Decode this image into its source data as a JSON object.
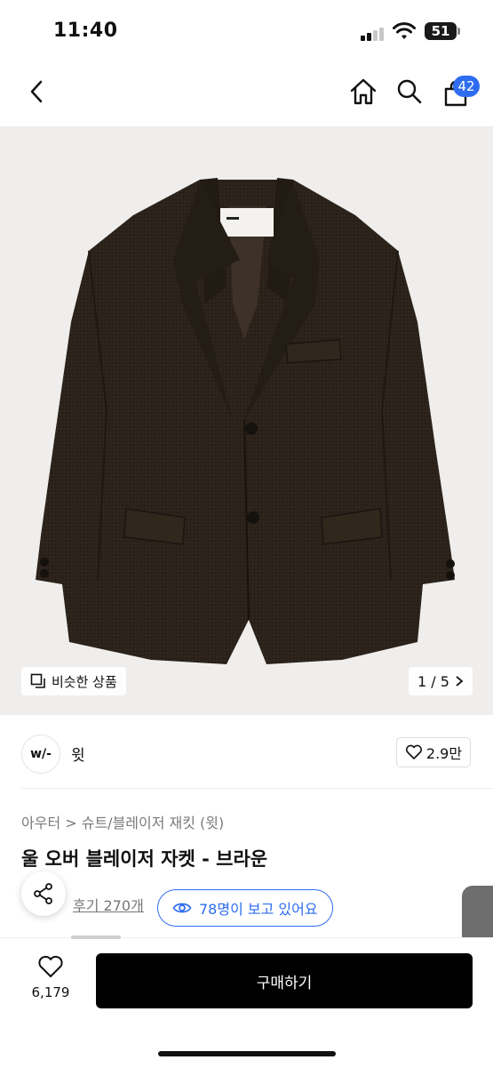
{
  "status_bar": {
    "time": "11:40",
    "battery": "51"
  },
  "nav": {
    "cart_count": "42",
    "icons": [
      "back-icon",
      "home-icon",
      "search-icon",
      "cart-icon"
    ]
  },
  "product": {
    "similar_label": "비슷한 상품",
    "pager": "1 / 5",
    "brand_logo": "w/-",
    "brand_name": "윗",
    "likes_short": "2.9만",
    "breadcrumb": "아우터 > 슈트/블레이저 재킷 (윗)",
    "title": "울 오버 블레이저 자켓 - 브라운",
    "review_link": "후기 270개",
    "viewing_now": "78명이 보고 있어요",
    "jacket_color": "#2b231b"
  },
  "bottom": {
    "like_count": "6,179",
    "buy_label": "구매하기"
  },
  "colors": {
    "accent": "#2e6cf0",
    "buy_button": "#000000"
  }
}
